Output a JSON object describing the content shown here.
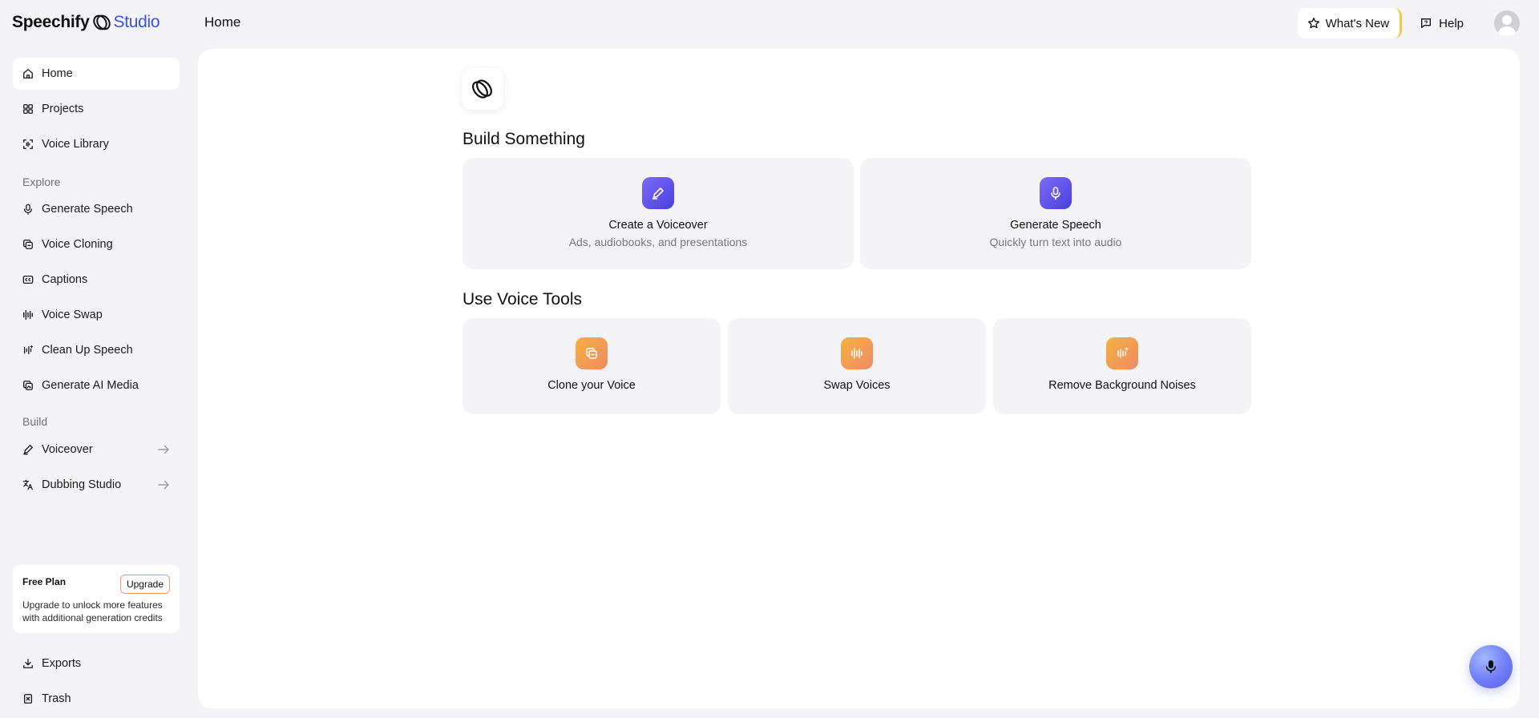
{
  "app": {
    "brand_name": "Speechify",
    "brand_suffix": "Studio",
    "page_title": "Home"
  },
  "header": {
    "whats_new_label": "What's New",
    "help_label": "Help"
  },
  "sidebar": {
    "primary_items": [
      {
        "label": "Home",
        "icon": "home-icon",
        "active": true
      },
      {
        "label": "Projects",
        "icon": "grid-icon"
      },
      {
        "label": "Voice Library",
        "icon": "voice-library-icon"
      }
    ],
    "explore_label": "Explore",
    "explore_items": [
      {
        "label": "Generate Speech",
        "icon": "microphone-icon"
      },
      {
        "label": "Voice Cloning",
        "icon": "clone-icon"
      },
      {
        "label": "Captions",
        "icon": "captions-icon"
      },
      {
        "label": "Voice Swap",
        "icon": "waveform-icon"
      },
      {
        "label": "Clean Up Speech",
        "icon": "sparkle-wave-icon"
      },
      {
        "label": "Generate AI Media",
        "icon": "media-icon"
      }
    ],
    "build_label": "Build",
    "build_items": [
      {
        "label": "Voiceover",
        "icon": "pen-icon"
      },
      {
        "label": "Dubbing Studio",
        "icon": "translate-icon"
      }
    ],
    "plan": {
      "title": "Free Plan",
      "upgrade_label": "Upgrade",
      "description": "Upgrade to unlock more features with additional generation credits"
    },
    "bottom_items": [
      {
        "label": "Exports",
        "icon": "download-icon"
      },
      {
        "label": "Trash",
        "icon": "trash-icon"
      }
    ]
  },
  "main": {
    "build_heading": "Build Something",
    "build_cards": [
      {
        "title": "Create a Voiceover",
        "subtitle": "Ads, audiobooks, and presentations",
        "icon": "pen-icon"
      },
      {
        "title": "Generate Speech",
        "subtitle": "Quickly turn text into audio",
        "icon": "microphone-icon"
      }
    ],
    "tools_heading": "Use Voice Tools",
    "tool_cards": [
      {
        "title": "Clone your Voice",
        "icon": "clone-icon"
      },
      {
        "title": "Swap Voices",
        "icon": "waveform-icon"
      },
      {
        "title": "Remove Background Noises",
        "icon": "noise-icon"
      }
    ]
  },
  "colors": {
    "accent_blue": "#4a3fe0",
    "accent_orange": "#f5b13d",
    "brand_studio": "#3b55d9",
    "upgrade_border": "#f09a6c"
  }
}
